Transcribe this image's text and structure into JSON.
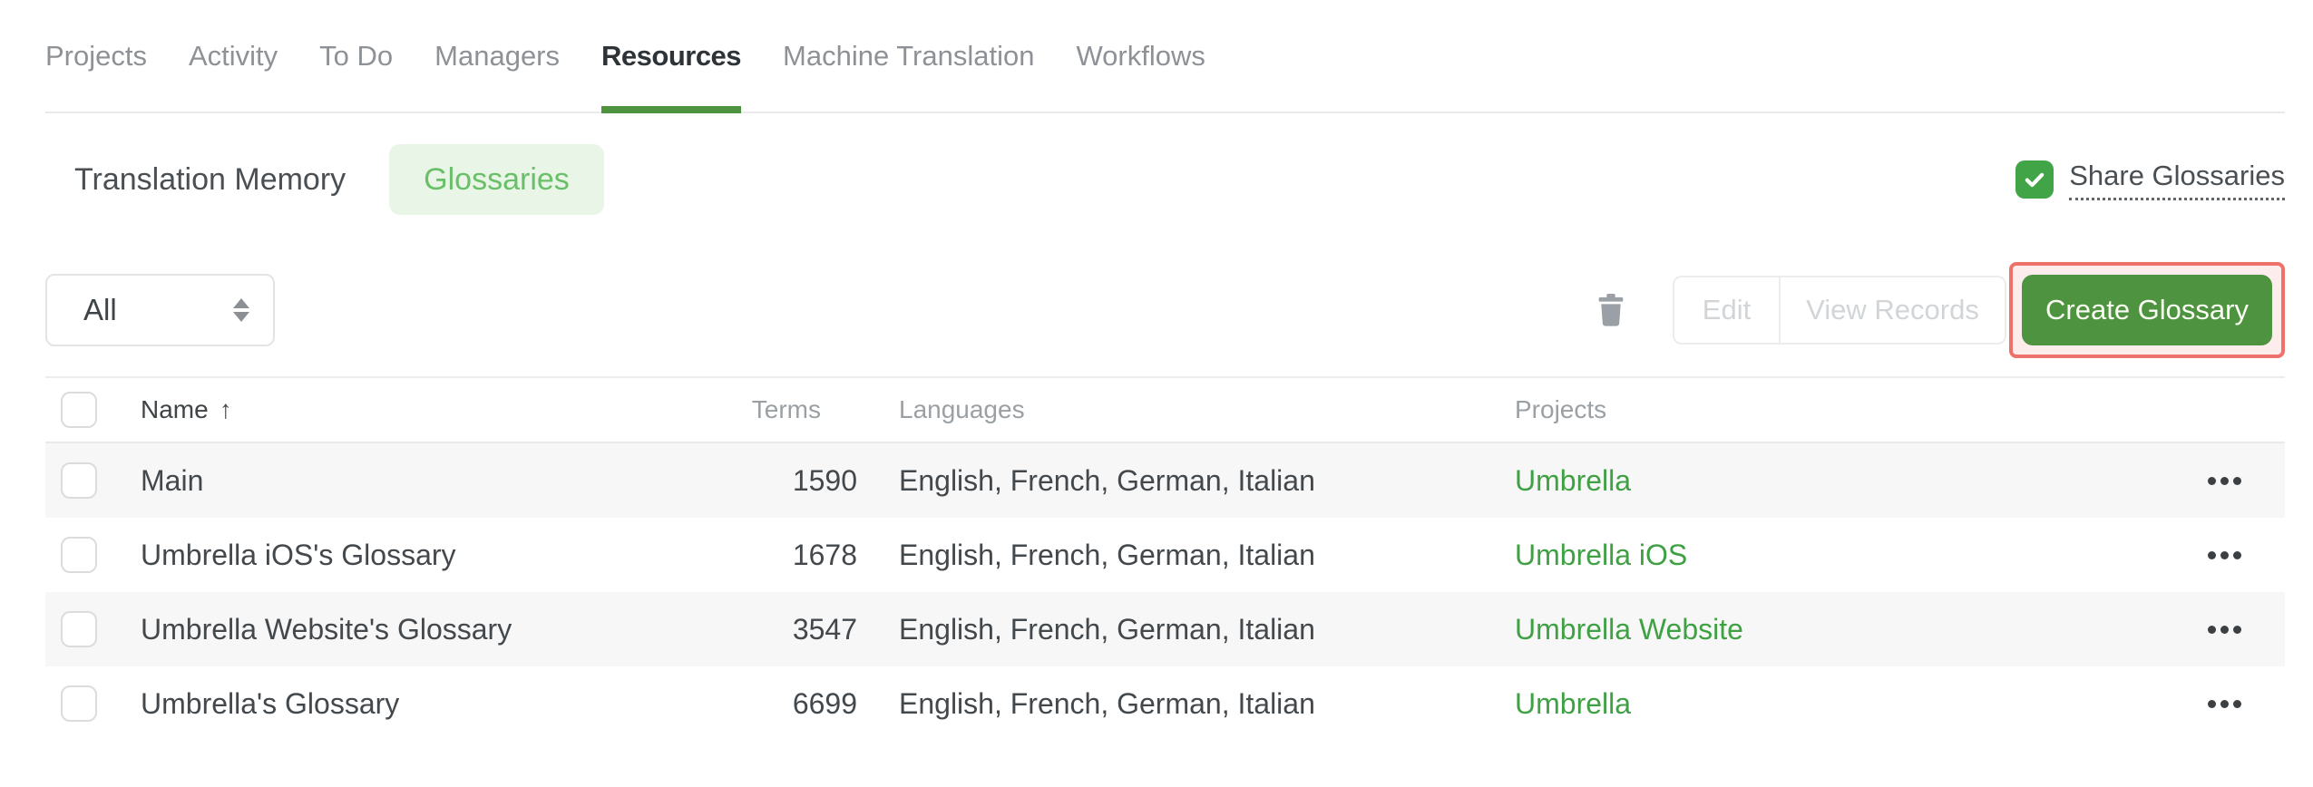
{
  "nav": {
    "tabs": [
      {
        "label": "Projects",
        "active": false
      },
      {
        "label": "Activity",
        "active": false
      },
      {
        "label": "To Do",
        "active": false
      },
      {
        "label": "Managers",
        "active": false
      },
      {
        "label": "Resources",
        "active": true
      },
      {
        "label": "Machine Translation",
        "active": false
      },
      {
        "label": "Workflows",
        "active": false
      }
    ]
  },
  "subnav": {
    "translation_memory_label": "Translation Memory",
    "glossaries_label": "Glossaries",
    "share": {
      "label": "Share Glossaries",
      "checked": true
    }
  },
  "toolbar": {
    "filter": {
      "value": "All"
    },
    "edit_label": "Edit",
    "view_records_label": "View Records",
    "create_label": "Create Glossary"
  },
  "table": {
    "headers": {
      "name": "Name",
      "terms": "Terms",
      "languages": "Languages",
      "projects": "Projects"
    },
    "sort": {
      "column": "Name",
      "direction": "ascending",
      "arrow": "↑"
    },
    "rows": [
      {
        "name": "Main",
        "terms": "1590",
        "languages": "English, French, German, Italian",
        "project": "Umbrella"
      },
      {
        "name": "Umbrella iOS's Glossary",
        "terms": "1678",
        "languages": "English, French, German, Italian",
        "project": "Umbrella iOS"
      },
      {
        "name": "Umbrella Website's Glossary",
        "terms": "3547",
        "languages": "English, French, German, Italian",
        "project": "Umbrella Website"
      },
      {
        "name": "Umbrella's Glossary",
        "terms": "6699",
        "languages": "English, French, German, Italian",
        "project": "Umbrella"
      }
    ]
  },
  "icons": {
    "trash": "trash-can",
    "dropdown_caret": "up-down-triangles",
    "share_check": "checkmark",
    "sort_ascending": "up-arrow",
    "row_menu": "three-dots"
  },
  "colors": {
    "brand_green": "#4e9340",
    "toggle_green": "#41a447",
    "link_green": "#3fa044",
    "glossaries_pill_bg": "#e9f5e6",
    "glossaries_pill_text": "#6abf69",
    "annotation_border": "#ef716b",
    "annotation_bg": "#fdecec",
    "row_alt_bg": "#f7f7f7",
    "inactive_tab_text": "#8e9296",
    "disabled_button_text": "#d2d5d7"
  }
}
